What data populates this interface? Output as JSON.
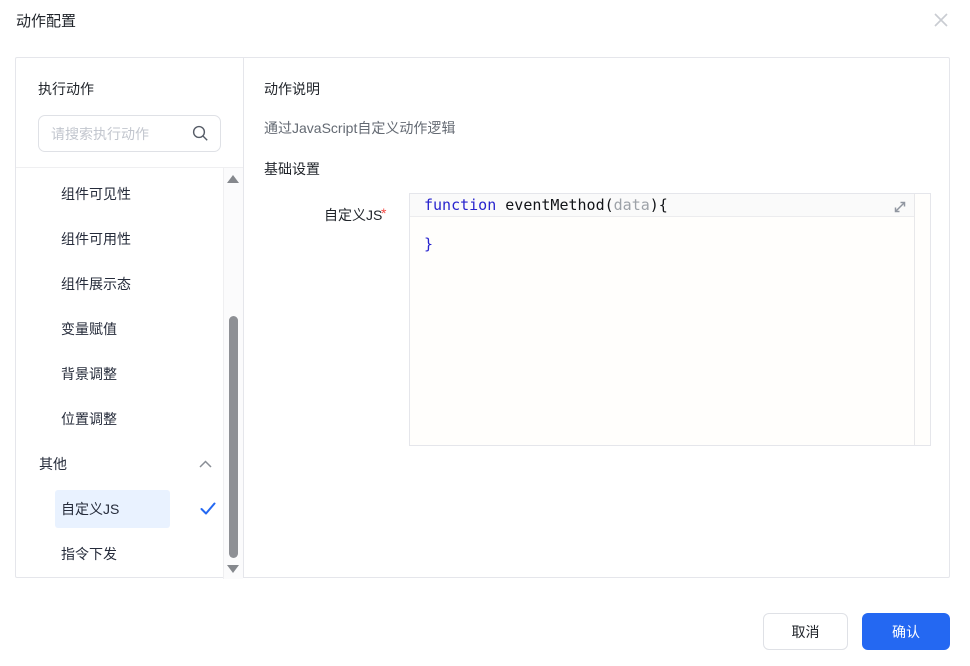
{
  "dialog": {
    "title": "动作配置"
  },
  "icons": {
    "close": "x-cross",
    "search": "magnifier",
    "group_collapse": "chevron-up",
    "selected_check": "check-mark",
    "editor_expand": "diagonal-resize-arrows",
    "scroll_up": "triangle-up",
    "scroll_down": "triangle-down"
  },
  "left_panel": {
    "header": "执行动作",
    "search": {
      "placeholder": "请搜索执行动作",
      "value": ""
    },
    "list": {
      "items": [
        {
          "id": "component-visibility",
          "label": "组件可见性",
          "type": "child",
          "selected": false
        },
        {
          "id": "component-usability",
          "label": "组件可用性",
          "type": "child",
          "selected": false
        },
        {
          "id": "component-display-state",
          "label": "组件展示态",
          "type": "child",
          "selected": false
        },
        {
          "id": "variable-assignment",
          "label": "变量赋值",
          "type": "child",
          "selected": false
        },
        {
          "id": "background-adjust",
          "label": "背景调整",
          "type": "child",
          "selected": false
        },
        {
          "id": "position-adjust",
          "label": "位置调整",
          "type": "child",
          "selected": false
        },
        {
          "id": "other-group",
          "label": "其他",
          "type": "group",
          "expanded": true
        },
        {
          "id": "custom-js",
          "label": "自定义JS",
          "type": "child",
          "selected": true
        },
        {
          "id": "command-dispatch",
          "label": "指令下发",
          "type": "child",
          "selected": false
        }
      ]
    }
  },
  "right_panel": {
    "desc_header": "动作说明",
    "desc_text": "通过JavaScript自定义动作逻辑",
    "settings_header": "基础设置",
    "form": {
      "label": "自定义JS",
      "required_marker": "*",
      "code": {
        "lines": [
          [
            {
              "t": "function",
              "c": "k"
            },
            {
              "t": " ",
              "c": "p"
            },
            {
              "t": "eventMethod",
              "c": "p"
            },
            {
              "t": "(",
              "c": "p"
            },
            {
              "t": "data",
              "c": "m"
            },
            {
              "t": "){",
              "c": "p"
            }
          ],
          [],
          [
            {
              "t": "}",
              "c": "k"
            }
          ]
        ]
      }
    }
  },
  "footer": {
    "cancel_label": "取消",
    "confirm_label": "确认"
  },
  "colors": {
    "accent": "#2468f2",
    "selected-bg": "#e9f2ff",
    "text-dark": "#1f2329",
    "text-gray": "#646a73",
    "placeholder": "#c2c6ce",
    "border": "#e5e6eb",
    "input-border": "#dfe1e6",
    "thumb": "#8e9095",
    "danger": "#f54a45",
    "code-keyword": "#2723ce",
    "code-muted": "#9da2a8"
  }
}
